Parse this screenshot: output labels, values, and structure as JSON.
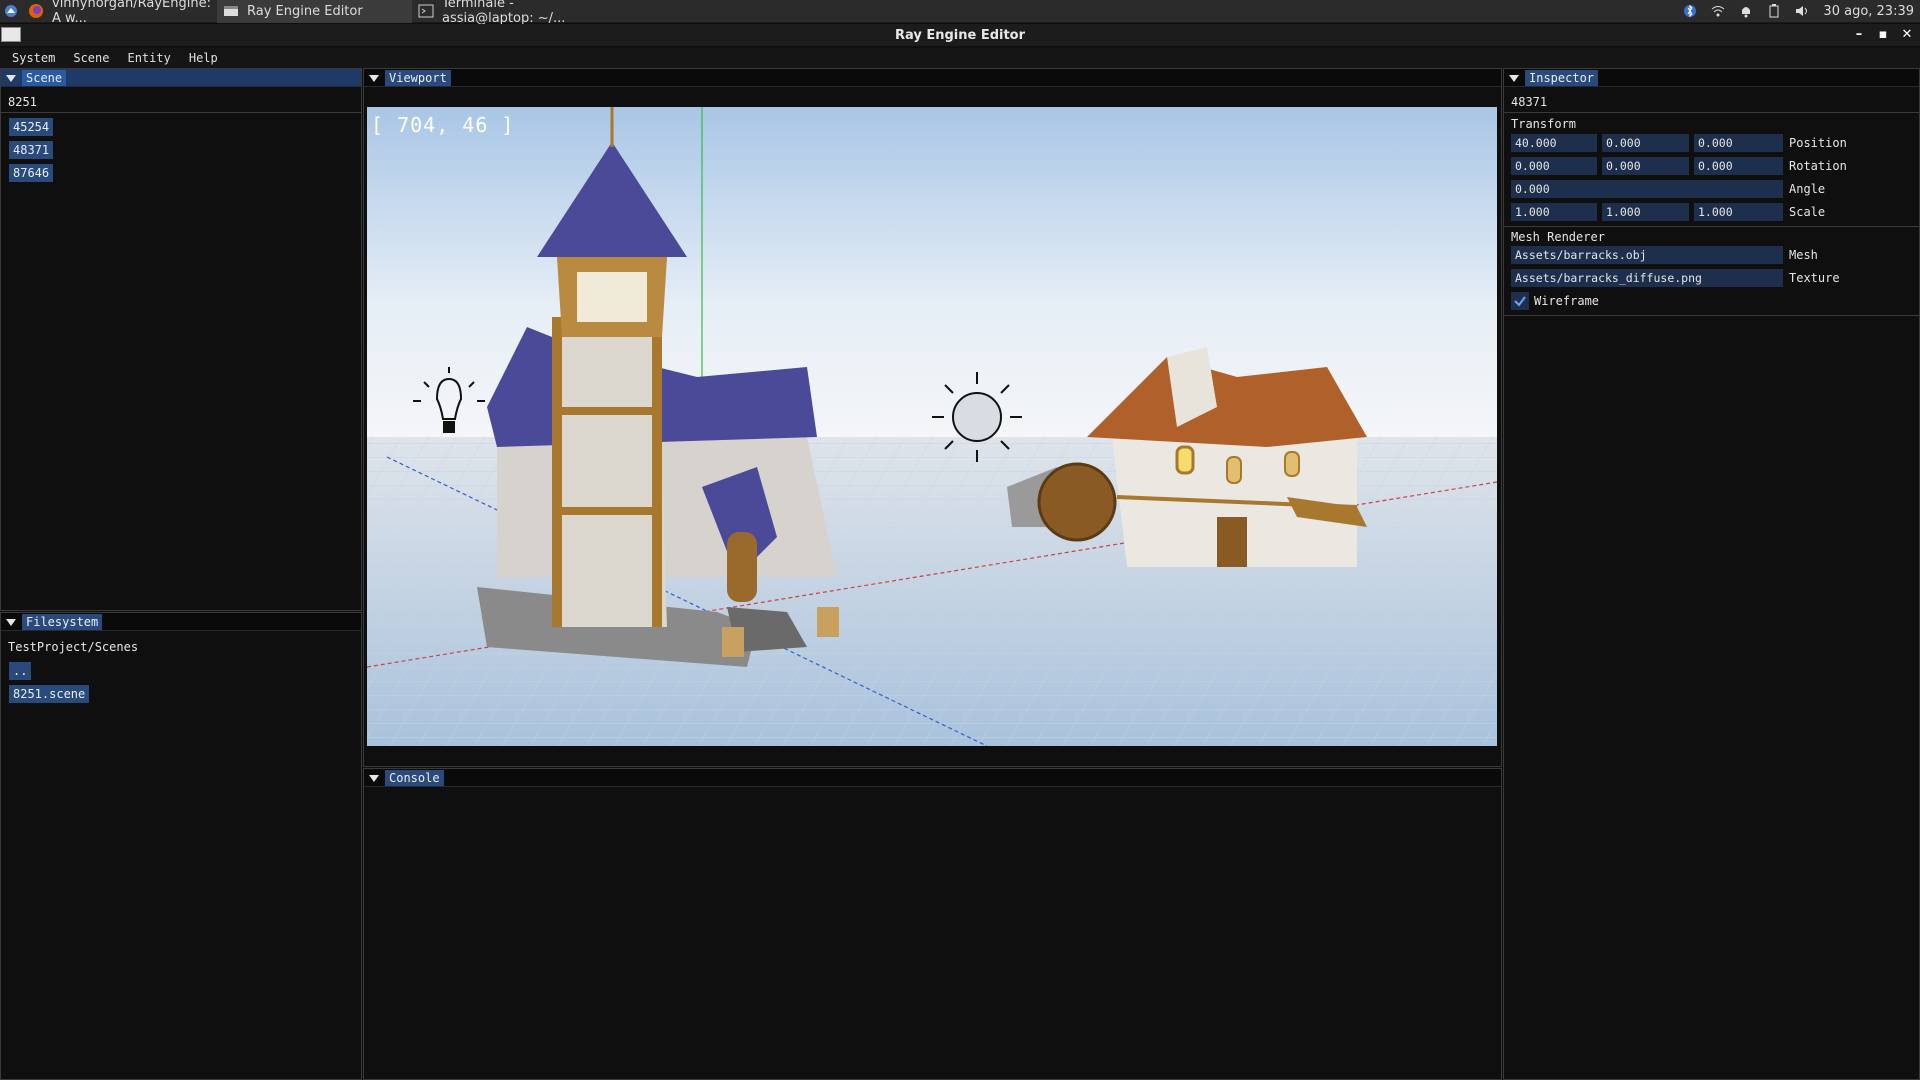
{
  "taskbar": {
    "tasks": [
      {
        "label": "vinnyhorgan/RayEngine: A w..."
      },
      {
        "label": "Ray Engine Editor"
      },
      {
        "label": "Terminale - assia@laptop: ~/..."
      }
    ],
    "clock": "30 ago, 23:39"
  },
  "window": {
    "title": "Ray Engine Editor"
  },
  "menu": [
    "System",
    "Scene",
    "Entity",
    "Help"
  ],
  "scene_panel": {
    "tab": "Scene",
    "root": "8251",
    "entities": [
      "45254",
      "48371",
      "87646"
    ]
  },
  "filesystem_panel": {
    "tab": "Filesystem",
    "path": "TestProject/Scenes",
    "items": [
      "..",
      "8251.scene"
    ]
  },
  "viewport_panel": {
    "tab": "Viewport",
    "overlay": "[ 704, 46 ]"
  },
  "console_panel": {
    "tab": "Console"
  },
  "inspector": {
    "tab": "Inspector",
    "entity_id": "48371",
    "transform_title": "Transform",
    "position": {
      "label": "Position",
      "x": "40.000",
      "y": "0.000",
      "z": "0.000"
    },
    "rotation": {
      "label": "Rotation",
      "x": "0.000",
      "y": "0.000",
      "z": "0.000"
    },
    "angle": {
      "label": "Angle",
      "value": "0.000"
    },
    "scale": {
      "label": "Scale",
      "x": "1.000",
      "y": "1.000",
      "z": "1.000"
    },
    "mesh_renderer_title": "Mesh Renderer",
    "mesh": {
      "label": "Mesh",
      "value": "Assets/barracks.obj"
    },
    "texture": {
      "label": "Texture",
      "value": "Assets/barracks_diffuse.png"
    },
    "wireframe": {
      "label": "Wireframe",
      "checked": true
    }
  },
  "colors": {
    "accent": "#294a7a",
    "field": "#1d2f4c",
    "panel_bg": "#0f0f0f",
    "church_roof": "#4a4a9a",
    "house_roof": "#b0602a"
  }
}
